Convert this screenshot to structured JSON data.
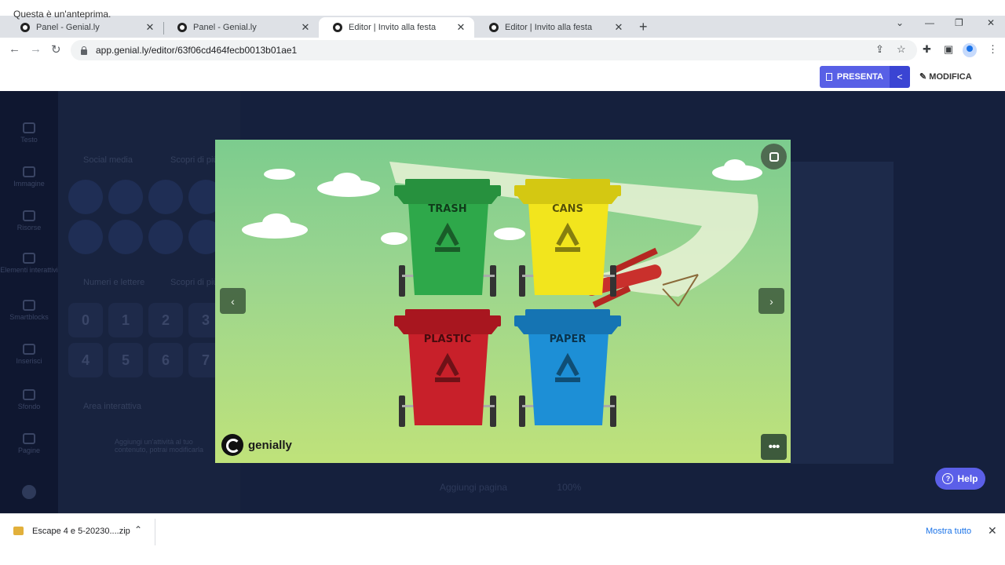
{
  "browser": {
    "tabs": [
      {
        "title": "Panel - Genial.ly",
        "active": false
      },
      {
        "title": "Panel - Genial.ly",
        "active": false
      },
      {
        "title": "Editor | Invito alla festa",
        "active": true
      },
      {
        "title": "Editor | Invito alla festa",
        "active": false
      }
    ],
    "new_tab": "+",
    "url": "app.genial.ly/editor/63f06cd464fecb0013b01ae1",
    "window_controls": {
      "minimize": "—",
      "maximize": "❐",
      "close": "✕",
      "tab_search": "⌄"
    }
  },
  "preview": {
    "notice": "Questa è un'anteprima.",
    "presenta_label": "PRESENTA",
    "modifica_label": "MODIFICA"
  },
  "editor_bg": {
    "rail": [
      "Testo",
      "Immagine",
      "Risorse",
      "Elementi interattivi",
      "Smartblocks",
      "Inserisci",
      "Sfondo",
      "Pagine"
    ],
    "section_social": "Social media",
    "section_numbers": "Numeri e lettere",
    "section_area": "Area interattiva",
    "scopri": "Scopri di più",
    "numbers": [
      "0",
      "1",
      "2",
      "3",
      "4",
      "5",
      "6",
      "7"
    ],
    "area_hint": "Aggiungi un'attività al tuo contenuto, potrai modificarla",
    "add_page": "Aggiungi pagina",
    "zoom": "100%"
  },
  "slide": {
    "bins": [
      {
        "label": "TRASH",
        "color": "#2ea84a",
        "lid": "#27913e"
      },
      {
        "label": "CANS",
        "color": "#f2e51d",
        "lid": "#d4c812"
      },
      {
        "label": "PLASTIC",
        "color": "#c8202a",
        "lid": "#a8161f"
      },
      {
        "label": "PAPER",
        "color": "#1d8fd6",
        "lid": "#1574b3"
      }
    ],
    "brand_name": "genially"
  },
  "help": {
    "label": "Help"
  },
  "downloads": {
    "file_name": "Escape 4 e 5-20230....zip",
    "show_all": "Mostra tutto"
  },
  "icons": {
    "back": "←",
    "forward": "→",
    "reload": "↻",
    "share": "⇪",
    "star": "☆",
    "extensions": "✚",
    "sidebar": "▣",
    "menu": "⋮",
    "prev": "‹",
    "next": "›",
    "more": "•••",
    "close": "✕",
    "chevron_up": "⌃"
  }
}
